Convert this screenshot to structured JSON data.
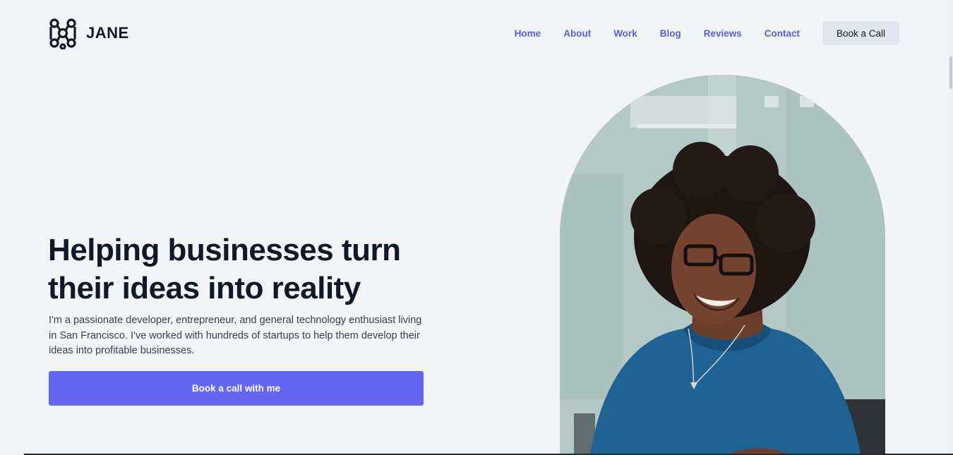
{
  "brand": {
    "name": "JANE",
    "logo_icon": "molecule-network-icon"
  },
  "nav": {
    "items": [
      {
        "label": "Home"
      },
      {
        "label": "About"
      },
      {
        "label": "Work"
      },
      {
        "label": "Blog"
      },
      {
        "label": "Reviews"
      },
      {
        "label": "Contact"
      }
    ],
    "cta_label": "Book a Call"
  },
  "hero": {
    "title_line1": "Helping businesses turn",
    "title_line2": "their ideas into reality",
    "description": "I'm a passionate developer, entrepreneur, and general technology enthusiast living in San Francisco. I've worked with hundreds of startups to help them develop their ideas into profitable businesses.",
    "button_label": "Book a call with me",
    "portrait_alt": "Portrait of a smiling woman with curly hair and glasses"
  },
  "colors": {
    "accent": "#6366f1",
    "nav_link": "#5a5fd6",
    "background": "#f3f4f6",
    "heading": "#111827"
  }
}
